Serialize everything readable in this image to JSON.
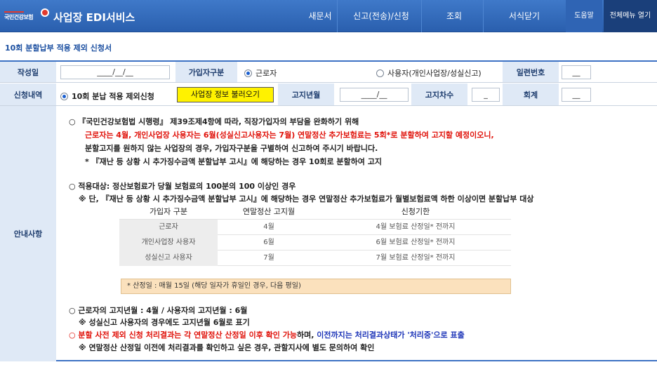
{
  "header": {
    "logo_text": "국민건강보험",
    "app_title": "사업장 EDI서비스",
    "nav": [
      "새문서",
      "신고(전송)/신청",
      "조회",
      "서식닫기"
    ],
    "help_label": "도움말",
    "all_menu_label": "전체메뉴 열기"
  },
  "page_title": "10회 분할납부 적용 제외 신청서",
  "form": {
    "write_date_label": "작성일",
    "write_date_value": "____/__/__",
    "subscriber_type_label": "가입자구분",
    "subscriber_options": [
      "근로자",
      "사용자(개인사업장/성실신고)"
    ],
    "serial_label": "일련번호",
    "serial_value": "__",
    "request_label": "신청내역",
    "request_option": "10회 분납 적용 제외신청",
    "load_button": "사업장 정보 불러오기",
    "notice_month_label": "고지년월",
    "notice_month_value": "____/__",
    "notice_seq_label": "고지차수",
    "notice_seq_value": "_",
    "total_label": "회계",
    "total_value": "__"
  },
  "guide": {
    "label": "안내사항",
    "p1_line1": "○  『국민건강보험법 시행령』 제39조제4항에 따라, 직장가입자의 부담을 완화하기 위해",
    "p1_line2": "근로자는 4월, 개인사업장 사용자는 6월(성실신고사용자는 7월) 연말정산 추가보험료는 5회*로 분할하여 고지할 예정이오니,",
    "p1_line3": "분할고지를 원하지 않는 사업장의 경우, 가입자구분을 구별하여 신고하여 주시기 바랍니다.",
    "p1_line4": "*  『재난 등 상황 시 추가징수금액 분할납부 고시』에 해당하는 경우 10회로 분할하여 고지",
    "p2_line1": "○ 적용대상: 정산보험료가 당월 보험료의 100분의 100 이상인 경우",
    "p2_line2": "※ 단, 『재난 등 상황 시 추가징수금액 분할납부 고시』에 해당하는 경우 연말정산 추가보험료가 월별보험료액 하한 이상이면 분할납부 대상",
    "table": {
      "headers": [
        "가입자 구분",
        "연말정산 고지월",
        "신청기한"
      ],
      "rows": [
        [
          "근로자",
          "4월",
          "4월 보험료 산정일* 전까지"
        ],
        [
          "개인사업장 사용자",
          "6월",
          "6월 보험료 산정일* 전까지"
        ],
        [
          "성실신고 사용자",
          "7월",
          "7월 보험료 산정일* 전까지"
        ]
      ]
    },
    "note": "* 산정일 : 매월 15일 (해당 일자가 휴일인 경우, 다음 평일)",
    "p3_line1": "○ 근로자의 고지년월 : 4월 / 사용자의 고지년월 : 6월",
    "p3_line2": "※ 성실신고 사용자의 경우에도 고지년월 6월로 표기",
    "p4_red": "○ 분할 사전 제외 신청 처리결과는 각 연말정산 산정일 이후 확인 가능",
    "p4_mid": "하며, ",
    "p4_blue": "이전까지는 처리결과상태가 '처리중'으로 표출",
    "p5_line1": "※ 연말정산 산정일 이전에 처리결과를 확인하고 싶은 경우, 관할지사에 별도 문의하여 확인"
  },
  "colors": {
    "nav_bg": "#2f66b8",
    "label_bg": "#dfe9f6",
    "highlight_button": "#fff200",
    "note_bg": "#fbe1bd",
    "red_text": "#e0120a",
    "blue_text": "#1d35b8"
  }
}
